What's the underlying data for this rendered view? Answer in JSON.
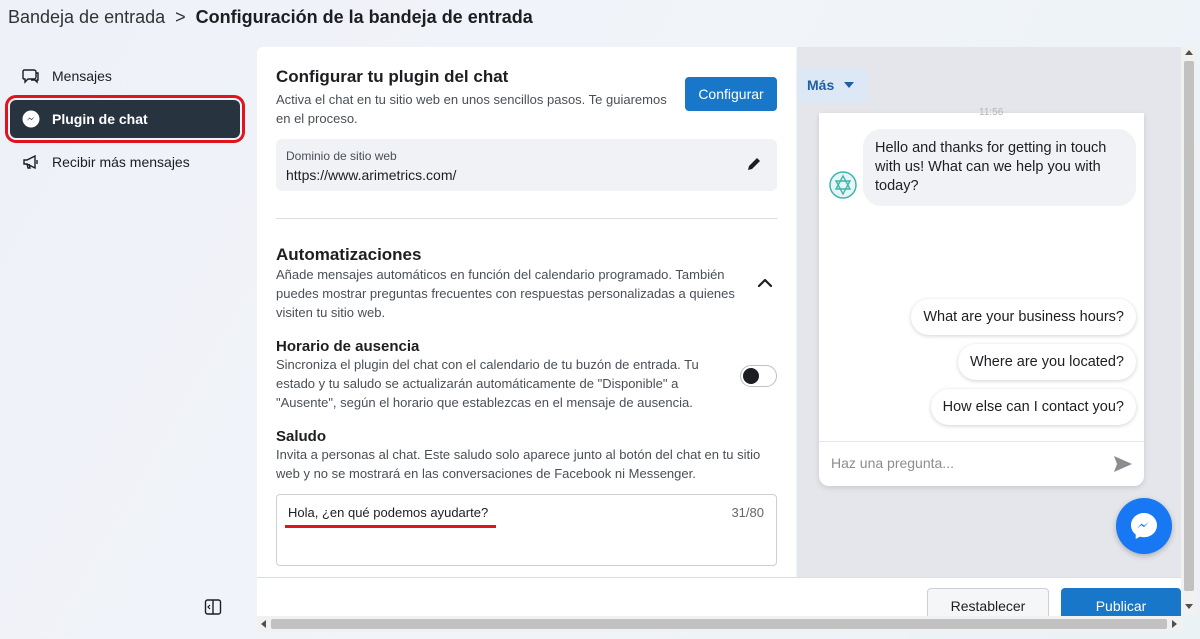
{
  "breadcrumb": {
    "parent": "Bandeja de entrada",
    "separator": ">",
    "current": "Configuración de la bandeja de entrada"
  },
  "sidebar": {
    "items": [
      {
        "label": "Mensajes",
        "icon": "chat-bubbles-icon",
        "active": false
      },
      {
        "label": "Plugin de chat",
        "icon": "messenger-icon",
        "active": true
      },
      {
        "label": "Recibir más mensajes",
        "icon": "megaphone-icon",
        "active": false
      }
    ]
  },
  "configure": {
    "title": "Configurar tu plugin del chat",
    "description": "Activa el chat en tu sitio web en unos sencillos pasos. Te guiaremos en el proceso.",
    "button_label": "Configurar"
  },
  "domain": {
    "label": "Dominio de sitio web",
    "value": "https://www.arimetrics.com/"
  },
  "automations": {
    "title": "Automatizaciones",
    "description": "Añade mensajes automáticos en función del calendario programado. También puedes mostrar preguntas frecuentes con respuestas personalizadas a quienes visiten tu sitio web."
  },
  "away": {
    "title": "Horario de ausencia",
    "description": "Sincroniza el plugin del chat con el calendario de tu buzón de entrada. Tu estado y tu saludo se actualizarán automáticamente de \"Disponible\" a \"Ausente\", según el horario que establezcas en el mensaje de ausencia.",
    "enabled": false
  },
  "greeting": {
    "title": "Saludo",
    "description": "Invita a personas al chat. Este saludo solo aparece junto al botón del chat en tu sitio web y no se mostrará en las conversaciones de Facebook ni Messenger.",
    "value": "Hola, ¿en qué podemos ayudarte?",
    "counter": "31/80"
  },
  "preview": {
    "more_label": "Más",
    "time": "11:56",
    "bot_message": "Hello and thanks for getting in touch with us! What can we help you with today?",
    "quick_replies": [
      "What are your business hours?",
      "Where are you located?",
      "How else can I contact you?"
    ],
    "input_placeholder": "Haz una pregunta..."
  },
  "footer": {
    "reset_label": "Restablecer",
    "publish_label": "Publicar"
  },
  "colors": {
    "primary_button": "#1877c9",
    "active_sidebar": "#283340",
    "highlight": "#e0141e",
    "messenger": "#1877f2"
  }
}
